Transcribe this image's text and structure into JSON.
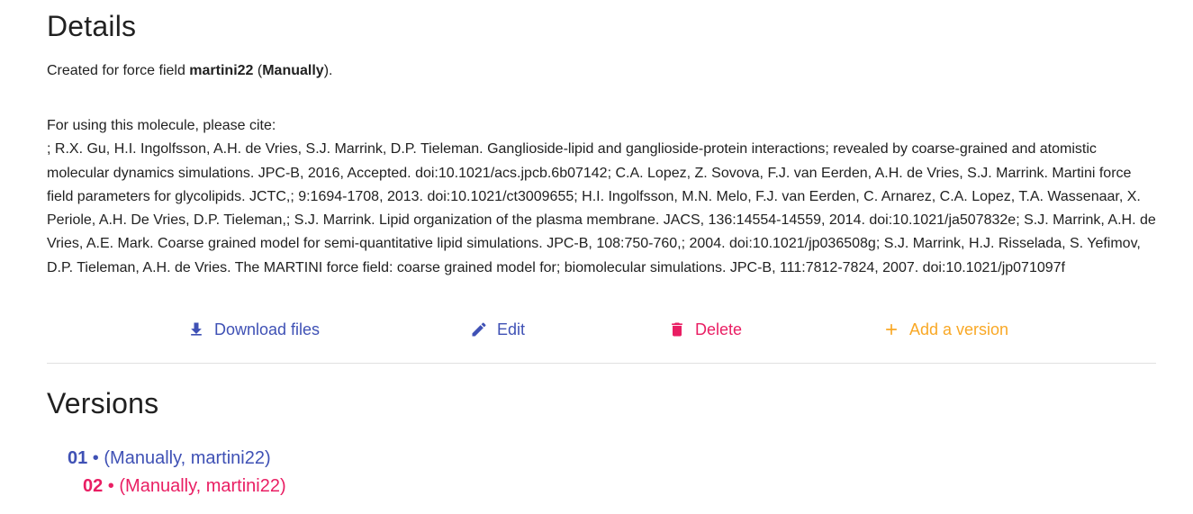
{
  "details": {
    "title": "Details",
    "created_prefix": "Created for force field ",
    "force_field": "martini22",
    "created_mid": " (",
    "method": "Manually",
    "created_suffix": ").",
    "cite_intro": "For using this molecule, please cite:",
    "citation": "; R.X. Gu, H.I. Ingolfsson, A.H. de Vries, S.J. Marrink, D.P. Tieleman. Ganglioside-lipid and ganglioside-protein interactions; revealed by coarse-grained and atomistic molecular dynamics simulations. JPC-B, 2016, Accepted. doi:10.1021/acs.jpcb.6b07142; C.A. Lopez, Z. Sovova, F.J. van Eerden, A.H. de Vries, S.J. Marrink. Martini force field parameters for glycolipids. JCTC,; 9:1694-1708, 2013. doi:10.1021/ct3009655; H.I. Ingolfsson, M.N. Melo, F.J. van Eerden, C. Arnarez, C.A. Lopez, T.A. Wassenaar, X. Periole, A.H. De Vries, D.P. Tieleman,; S.J. Marrink. Lipid organization of the plasma membrane. JACS, 136:14554-14559, 2014. doi:10.1021/ja507832e; S.J. Marrink, A.H. de Vries, A.E. Mark. Coarse grained model for semi-quantitative lipid simulations. JPC-B, 108:750-760,; 2004. doi:10.1021/jp036508g; S.J. Marrink, H.J. Risselada, S. Yefimov, D.P. Tieleman, A.H. de Vries. The MARTINI force field: coarse grained model for; biomolecular simulations. JPC-B, 111:7812-7824, 2007. doi:10.1021/jp071097f"
  },
  "actions": {
    "download": {
      "label": "Download files",
      "icon": "download-icon",
      "color": "#3f51b5"
    },
    "edit": {
      "label": "Edit",
      "icon": "pencil-icon",
      "color": "#3f51b5"
    },
    "delete": {
      "label": "Delete",
      "icon": "trash-icon",
      "color": "#e91e63"
    },
    "add_version": {
      "label": "Add a version",
      "icon": "plus-icon",
      "color": "#f9a825"
    }
  },
  "versions": {
    "title": "Versions",
    "items": [
      {
        "number": "01",
        "separator": " • ",
        "info": "(Manually, martini22)",
        "color": "#3f51b5"
      },
      {
        "number": "02",
        "separator": " • ",
        "info": "(Manually, martini22)",
        "color": "#e91e63"
      }
    ]
  }
}
